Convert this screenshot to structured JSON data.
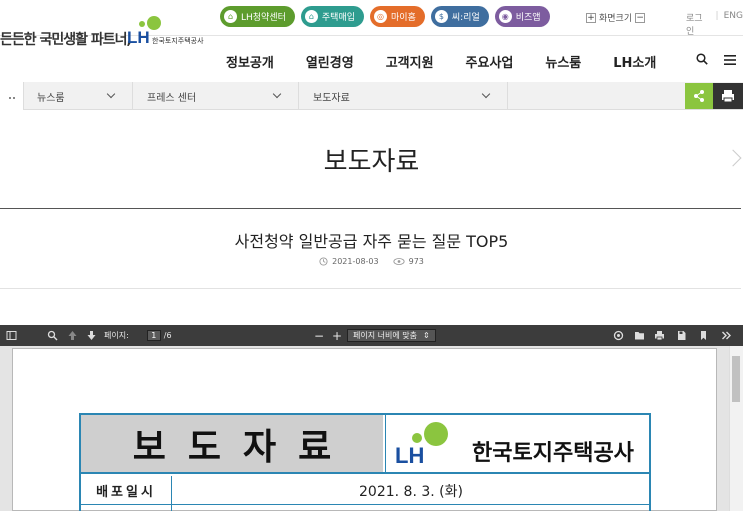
{
  "header": {
    "slogan": "든든한 국민생활 파트너,",
    "logo_text": "LH",
    "logo_sub": "한국토지주택공사",
    "quick_links": [
      {
        "label": "LH청약센터",
        "color": "#5d9c2d",
        "icon": "house-icon",
        "glyph": "⌂"
      },
      {
        "label": "주택매입",
        "color": "#2e9c8f",
        "icon": "home-buy-icon",
        "glyph": "⌂"
      },
      {
        "label": "마이홈",
        "color": "#e46d2a",
        "icon": "my-home-icon",
        "glyph": "◎"
      },
      {
        "label": "씨:리얼",
        "color": "#3f6e9f",
        "icon": "real-estate-icon",
        "glyph": "$"
      },
      {
        "label": "비즈앱",
        "color": "#7d5c9f",
        "icon": "biz-app-icon",
        "glyph": "◉"
      }
    ],
    "font_size_label": "화면크기",
    "font_plus": "+",
    "font_minus": "−",
    "login": "로그인",
    "eng": "ENG"
  },
  "nav": {
    "items": [
      "정보공개",
      "열린경영",
      "고객지원",
      "주요사업",
      "뉴스룸",
      "LH소개"
    ]
  },
  "location": {
    "items": [
      "뉴스룸",
      "프레스 센터",
      "보도자료"
    ]
  },
  "page": {
    "title": "보도자료"
  },
  "article": {
    "title": "사전청약 일반공급 자주 묻는 질문 TOP5",
    "date": "2021-08-03",
    "views": "973"
  },
  "pdf_viewer": {
    "page_label": "페이지:",
    "current_page": "1",
    "total_pages": "/6",
    "zoom_minus": "−",
    "zoom_plus": "+",
    "zoom_value": "페이지 너비에 맞춤"
  },
  "document": {
    "title": "보도자료",
    "company": "한국토지주택공사",
    "logo_text": "LH",
    "release_label": "배포일시",
    "release_date": "2021. 8. 3. (화)",
    "border_color": "#2b86b3"
  }
}
